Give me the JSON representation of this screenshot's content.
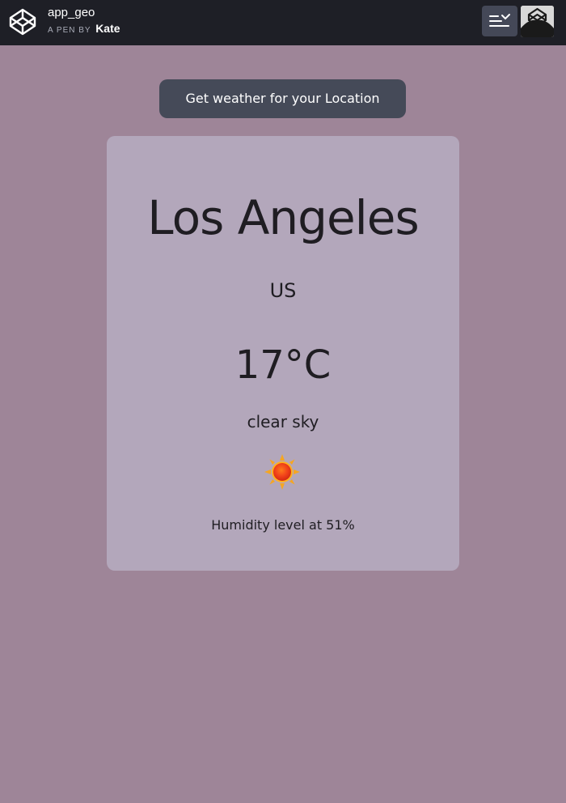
{
  "header": {
    "pen_title": "app_geo",
    "pen_by": "A PEN BY",
    "author": "Kate"
  },
  "action": {
    "button_label": "Get weather for your Location"
  },
  "weather": {
    "city": "Los Angeles",
    "country": "US",
    "temperature": "17°C",
    "description": "clear sky",
    "icon": "sun-icon",
    "humidity": "Humidity level at 51%"
  },
  "colors": {
    "page_background": "#9e8598",
    "card_background": "#b3a7bb",
    "button_background": "#454a58",
    "topbar_background": "#1e1f26"
  }
}
